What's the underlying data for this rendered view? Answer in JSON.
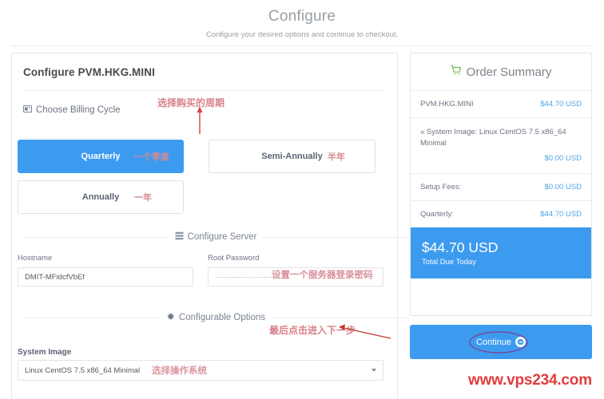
{
  "header": {
    "title": "Configure",
    "subtitle": "Configure your desired options and continue to checkout."
  },
  "left_panel": {
    "title": "Configure PVM.HKG.MINI",
    "billing": {
      "section_label": "Choose Billing Cycle",
      "icon": "credit-card-icon",
      "options": [
        {
          "label": "Quarterly",
          "annotation": "一个季度",
          "selected": true
        },
        {
          "label": "Semi-Annually",
          "annotation": "半年",
          "selected": false
        },
        {
          "label": "Annually",
          "annotation": "一年",
          "selected": false
        }
      ]
    },
    "configure_server": {
      "heading": "Configure Server",
      "icon": "server-icon",
      "hostname_label": "Hostname",
      "hostname_value": "DMIT-MFidcfVbEf",
      "password_label": "Root Password",
      "password_value": "····················"
    },
    "configurable_options": {
      "heading": "Configurable Options",
      "icon": "gear-icon",
      "system_image_label": "System Image",
      "system_image_value": "Linux CentOS 7.5 x86_64 Minimal"
    }
  },
  "order_summary": {
    "title": "Order Summary",
    "icon": "shopping-cart-icon",
    "product_name": "PVM.HKG.MINI",
    "product_price": "$44.70 USD",
    "config_line": "» System Image: Linux CentOS 7.5 x86_64 Minimal",
    "config_price": "$0.00 USD",
    "setup_label": "Setup Fees:",
    "setup_price": "$0.00 USD",
    "cycle_label": "Quarterly:",
    "cycle_price": "$44.70 USD",
    "total_amount": "$44.70 USD",
    "total_caption": "Total Due Today"
  },
  "continue_button": {
    "label": "Continue",
    "icon": "arrow-right-circle-icon"
  },
  "annotations": {
    "choose_cycle": "选择购买的周期",
    "set_password": "设置一个服务器登录密码",
    "choose_os": "选择操作系统",
    "final_step": "最后点击进入下一步"
  },
  "watermark": "www.vps234.com",
  "colors": {
    "accent_blue": "#3d9bef",
    "price_blue": "#4fa3e3",
    "annotation_red": "#d9808a",
    "watermark_red": "#e23b3b",
    "cart_green": "#6dbf4b"
  }
}
